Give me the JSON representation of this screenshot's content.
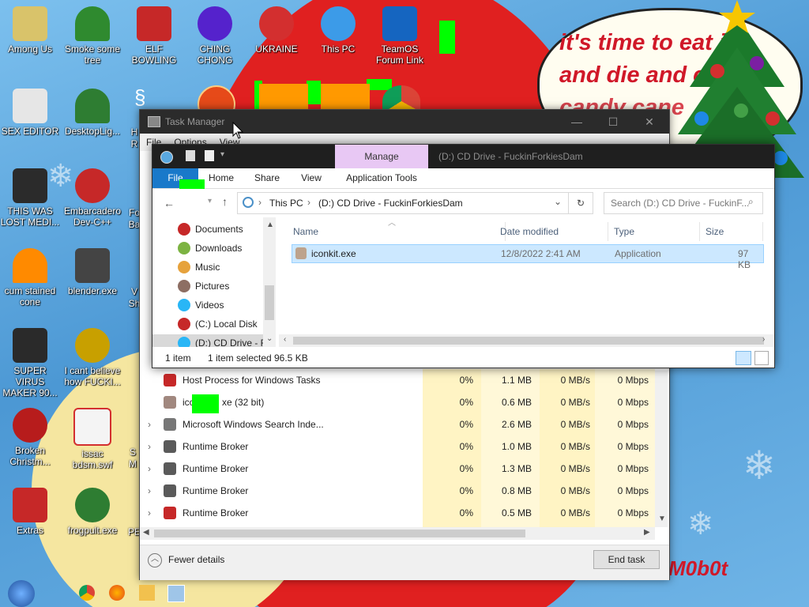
{
  "desktop": {
    "speech_text": [
      "it's time to eat it",
      "and die and c",
      "candy cane"
    ],
    "signature": "M0b0t",
    "icons": [
      {
        "label": "Among Us",
        "icon": "among-us-icon",
        "color": "#d9c36a"
      },
      {
        "label": "Smoke some tree",
        "icon": "christmas-tree-icon",
        "color": "#2f8a2f"
      },
      {
        "label": "ELF BOWLING",
        "icon": "elf-bowling-icon",
        "color": "#c62828"
      },
      {
        "label": "CHING CHONG",
        "icon": "ornament-icon",
        "color": "#5522cc"
      },
      {
        "label": "UKRAINE",
        "icon": "radiation-icon",
        "color": "#d32f2f"
      },
      {
        "label": "This PC",
        "icon": "computer-icon",
        "color": "#3c9be8"
      },
      {
        "label": "TeamOS Forum Link",
        "icon": "gear-icon",
        "color": "#1565c0"
      },
      {
        "label": "SEX EDITOR",
        "icon": "hex-editor-icon",
        "color": "#e6e6e6"
      },
      {
        "label": "DesktopLig...",
        "icon": "star-tree-icon",
        "color": "#2e7d32"
      },
      {
        "label": "THIS WAS LOST MEDI...",
        "icon": "cube-icon",
        "color": "#2b2b2b"
      },
      {
        "label": "Embarcadero Dev-C++",
        "icon": "devcpp-icon",
        "color": "#c62828"
      },
      {
        "label": "cum stained cone",
        "icon": "cone-icon",
        "color": "#ff8a00"
      },
      {
        "label": "blender.exe",
        "icon": "blender-icon",
        "color": "#444444"
      },
      {
        "label": "SUPER VIRUS MAKER 90...",
        "icon": "bag-icon",
        "color": "#2a2a2a"
      },
      {
        "label": "I cant believe how FUCKI...",
        "icon": "ball-icon",
        "color": "#c8a000"
      },
      {
        "label": "Broken Christm...",
        "icon": "ornament-icon",
        "color": "#b71c1c"
      },
      {
        "label": "issac bdsm.swf",
        "icon": "flash-icon",
        "color": "#d32f2f"
      },
      {
        "label": "Extras",
        "icon": "folder-icon",
        "color": "#c62828"
      },
      {
        "label": "frogpult.exe",
        "icon": "frog-icon",
        "color": "#2e7d32"
      }
    ],
    "partial_labels": [
      "H",
      "R",
      "Fo",
      "Ba",
      "V",
      "Sh",
      "S",
      "M",
      "PE"
    ]
  },
  "task_manager": {
    "title": "Task Manager",
    "menu": [
      "File",
      "Options",
      "View"
    ],
    "rows": [
      {
        "name": "Host Process for Windows Tasks",
        "cpu": "0%",
        "memory": "1.1 MB",
        "disk": "0 MB/s",
        "network": "0 Mbps",
        "expand": false,
        "icon_color": "#c62828"
      },
      {
        "name": "icc",
        "name_suffix": "xe (32 bit)",
        "cpu": "0%",
        "memory": "0.6 MB",
        "disk": "0 MB/s",
        "network": "0 Mbps",
        "expand": false,
        "icon_color": "#a1887f"
      },
      {
        "name": "Microsoft Windows Search Inde...",
        "cpu": "0%",
        "memory": "2.6 MB",
        "disk": "0 MB/s",
        "network": "0 Mbps",
        "expand": true,
        "icon_color": "#777777"
      },
      {
        "name": "Runtime Broker",
        "cpu": "0%",
        "memory": "1.0 MB",
        "disk": "0 MB/s",
        "network": "0 Mbps",
        "expand": true,
        "icon_color": "#5a5a5a"
      },
      {
        "name": "Runtime Broker",
        "cpu": "0%",
        "memory": "1.3 MB",
        "disk": "0 MB/s",
        "network": "0 Mbps",
        "expand": true,
        "icon_color": "#5a5a5a"
      },
      {
        "name": "Runtime Broker",
        "cpu": "0%",
        "memory": "0.8 MB",
        "disk": "0 MB/s",
        "network": "0 Mbps",
        "expand": true,
        "icon_color": "#5a5a5a"
      },
      {
        "name": "Runtime Broker",
        "cpu": "0%",
        "memory": "0.5 MB",
        "disk": "0 MB/s",
        "network": "0 Mbps",
        "expand": true,
        "icon_color": "#c62828"
      }
    ],
    "fewer_details": "Fewer details",
    "end_task": "End task"
  },
  "explorer": {
    "title": "(D:) CD Drive - FuckinForkiesDam",
    "context_tab": "Manage",
    "ribbon_tabs": [
      "File",
      "Home",
      "Share",
      "View",
      "Application Tools"
    ],
    "address": {
      "root": "This PC",
      "drive": "(D:) CD Drive - FuckinForkiesDam"
    },
    "search_placeholder": "Search (D:) CD Drive - FuckinF...",
    "nav": [
      {
        "label": "Documents",
        "color": "#c62828"
      },
      {
        "label": "Downloads",
        "color": "#7cb342"
      },
      {
        "label": "Music",
        "color": "#e6a23c"
      },
      {
        "label": "Pictures",
        "color": "#8d6e63"
      },
      {
        "label": "Videos",
        "color": "#29b6f6"
      },
      {
        "label": "(C:) Local Disk",
        "color": "#c62828"
      },
      {
        "label": "(D:) CD Drive - F",
        "color": "#29b6f6"
      }
    ],
    "columns": {
      "name": "Name",
      "date": "Date modified",
      "type": "Type",
      "size": "Size"
    },
    "file": {
      "name": "iconkit.exe",
      "date": "12/8/2022 2:41 AM",
      "type": "Application",
      "size": "97 KB"
    },
    "status": {
      "items": "1 item",
      "selected": "1 item selected",
      "size": "96.5 KB"
    }
  }
}
